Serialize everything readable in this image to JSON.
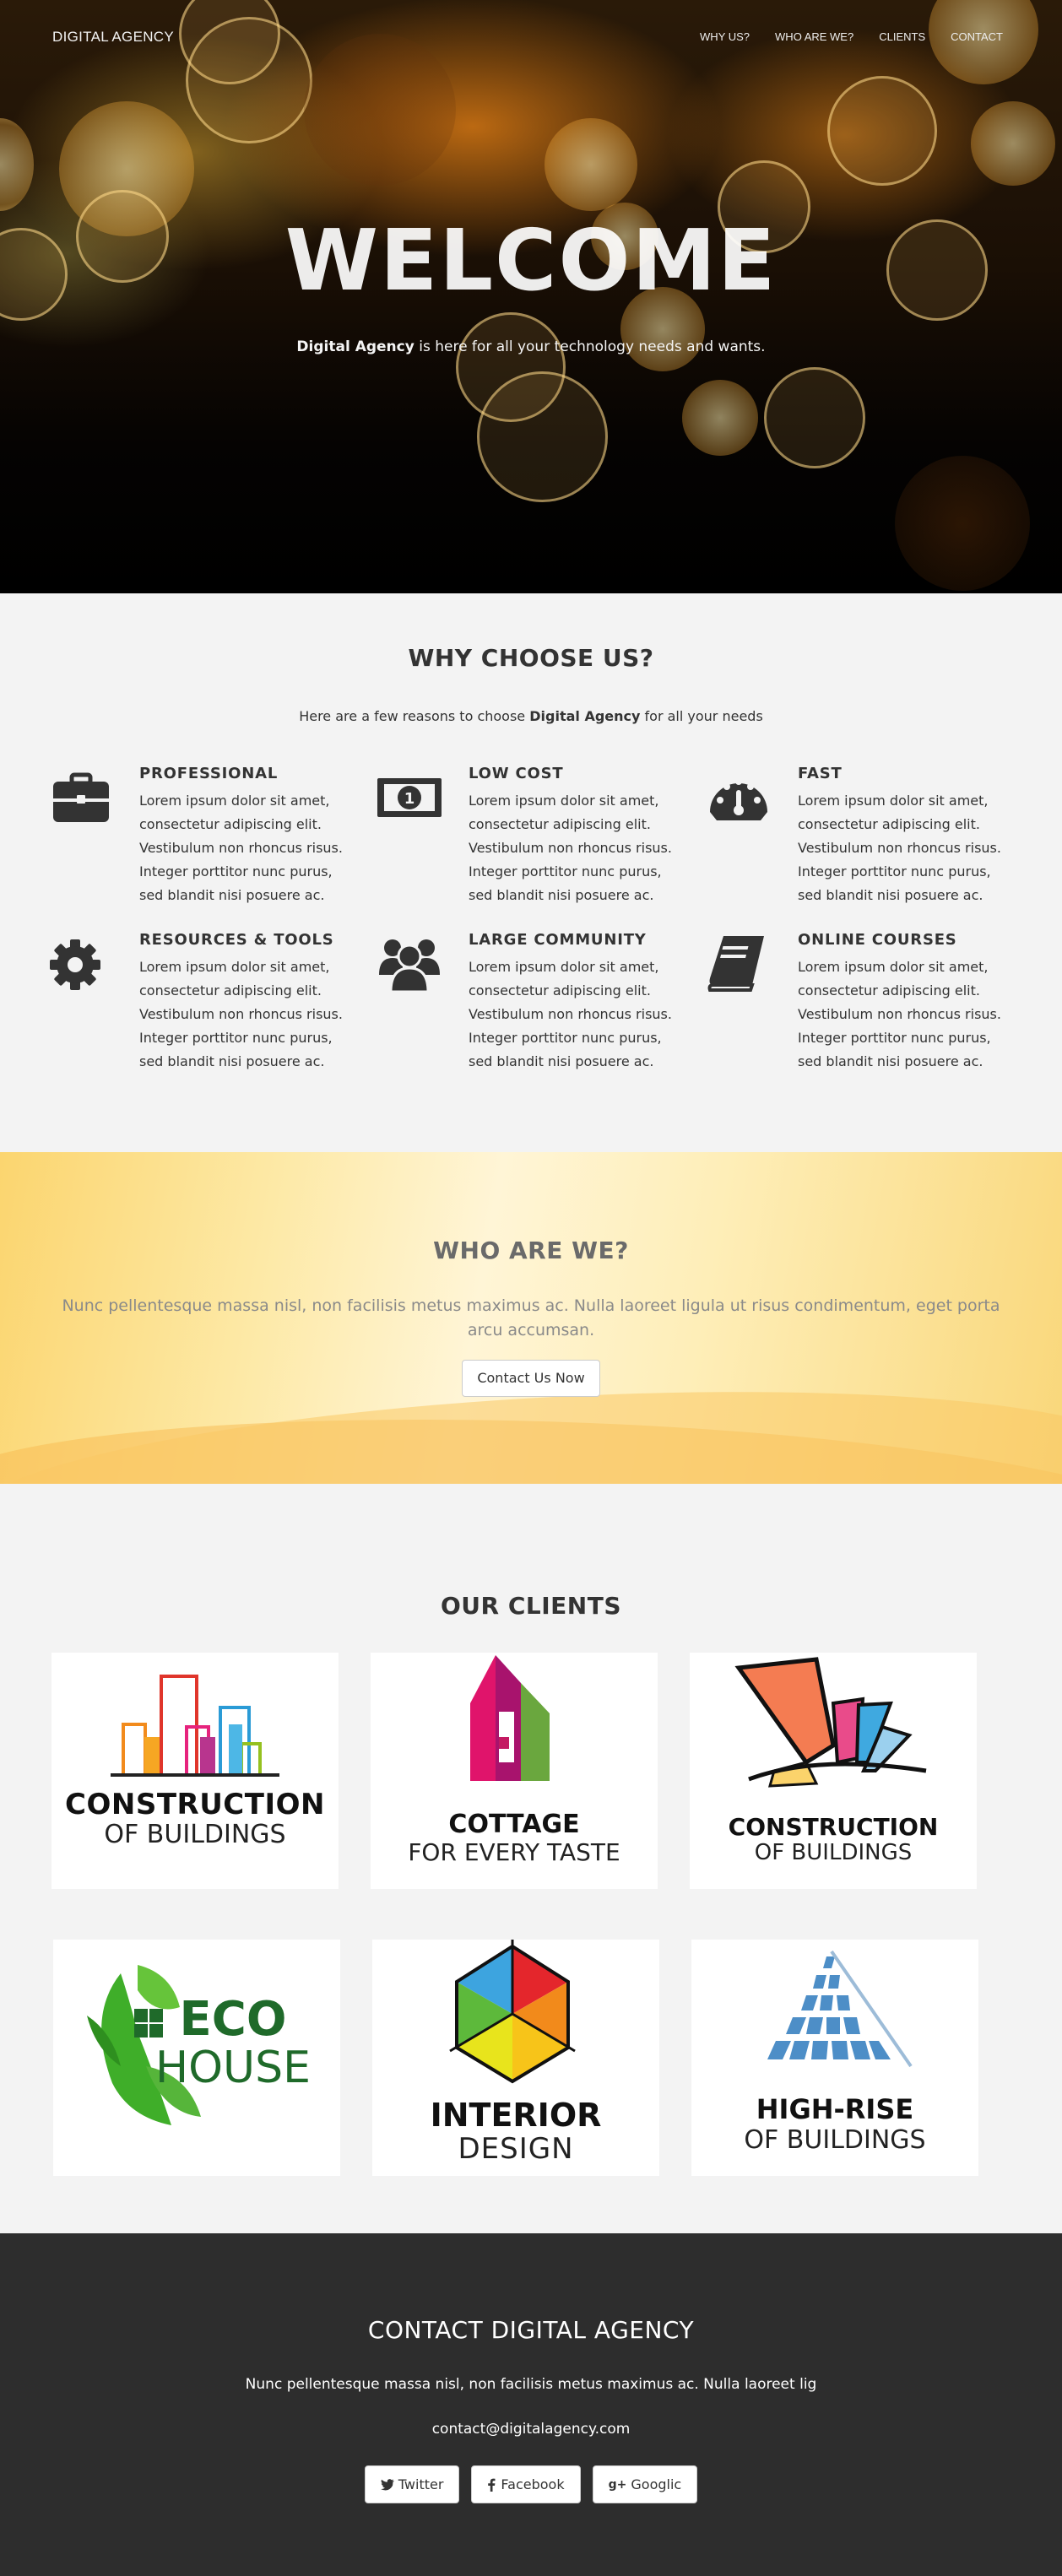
{
  "nav": {
    "brand": "DIGITAL AGENCY",
    "links": [
      "WHY US?",
      "WHO ARE WE?",
      "CLIENTS",
      "CONTACT"
    ]
  },
  "hero": {
    "title": "WELCOME",
    "subtitle_brand": "Digital Agency",
    "subtitle_rest": " is here for all your technology needs and wants."
  },
  "why": {
    "title": "WHY CHOOSE US?",
    "intro_pre": "Here are a few reasons to choose ",
    "intro_brand": "Digital Agency",
    "intro_post": " for all your needs",
    "features": [
      {
        "title": "PROFESSIONAL",
        "icon": "briefcase-icon",
        "text": "Lorem ipsum dolor sit amet, consectetur adipiscing elit. Vestibulum non rhoncus risus. Integer porttitor nunc purus, sed blandit nisi posuere ac."
      },
      {
        "title": "LOW COST",
        "icon": "money-icon",
        "text": "Lorem ipsum dolor sit amet, consectetur adipiscing elit. Vestibulum non rhoncus risus. Integer porttitor nunc purus, sed blandit nisi posuere ac."
      },
      {
        "title": "FAST",
        "icon": "dashboard-icon",
        "text": "Lorem ipsum dolor sit amet, consectetur adipiscing elit. Vestibulum non rhoncus risus. Integer porttitor nunc purus, sed blandit nisi posuere ac."
      },
      {
        "title": "RESOURCES & TOOLS",
        "icon": "gear-icon",
        "text": "Lorem ipsum dolor sit amet, consectetur adipiscing elit. Vestibulum non rhoncus risus. Integer porttitor nunc purus, sed blandit nisi posuere ac."
      },
      {
        "title": "LARGE COMMUNITY",
        "icon": "users-icon",
        "text": "Lorem ipsum dolor sit amet, consectetur adipiscing elit. Vestibulum non rhoncus risus. Integer porttitor nunc purus, sed blandit nisi posuere ac."
      },
      {
        "title": "ONLINE COURSES",
        "icon": "book-icon",
        "text": "Lorem ipsum dolor sit amet, consectetur adipiscing elit. Vestibulum non rhoncus risus. Integer porttitor nunc purus, sed blandit nisi posuere ac."
      }
    ]
  },
  "who": {
    "title": "WHO ARE WE?",
    "text": "Nunc pellentesque massa nisl, non facilisis metus maximus ac. Nulla laoreet ligula ut risus condimentum, eget porta arcu accumsan.",
    "button": "Contact Us Now"
  },
  "clients": {
    "title": "OUR CLIENTS",
    "logos": [
      {
        "line1": "CONSTRUCTION",
        "line2": "OF BUILDINGS"
      },
      {
        "line1": "COTTAGE",
        "line2": "FOR EVERY TASTE"
      },
      {
        "line1": "CONSTRUCTION",
        "line2": "OF BUILDINGS"
      },
      {
        "line1": "ECO",
        "line2": "HOUSE"
      },
      {
        "line1": "INTERIOR",
        "line2": "DESIGN"
      },
      {
        "line1": "HIGH-RISE",
        "line2": "OF BUILDINGS"
      }
    ]
  },
  "contact": {
    "title": "CONTACT DIGITAL AGENCY",
    "text": "Nunc pellentesque massa nisl, non facilisis metus maximus ac. Nulla laoreet lig",
    "email": "contact@digitalagency.com",
    "buttons": [
      {
        "label": "Twitter",
        "icon": "twitter-icon"
      },
      {
        "label": "Facebook",
        "icon": "facebook-icon"
      },
      {
        "label": "Googlic",
        "icon": "google-plus-icon"
      }
    ]
  }
}
